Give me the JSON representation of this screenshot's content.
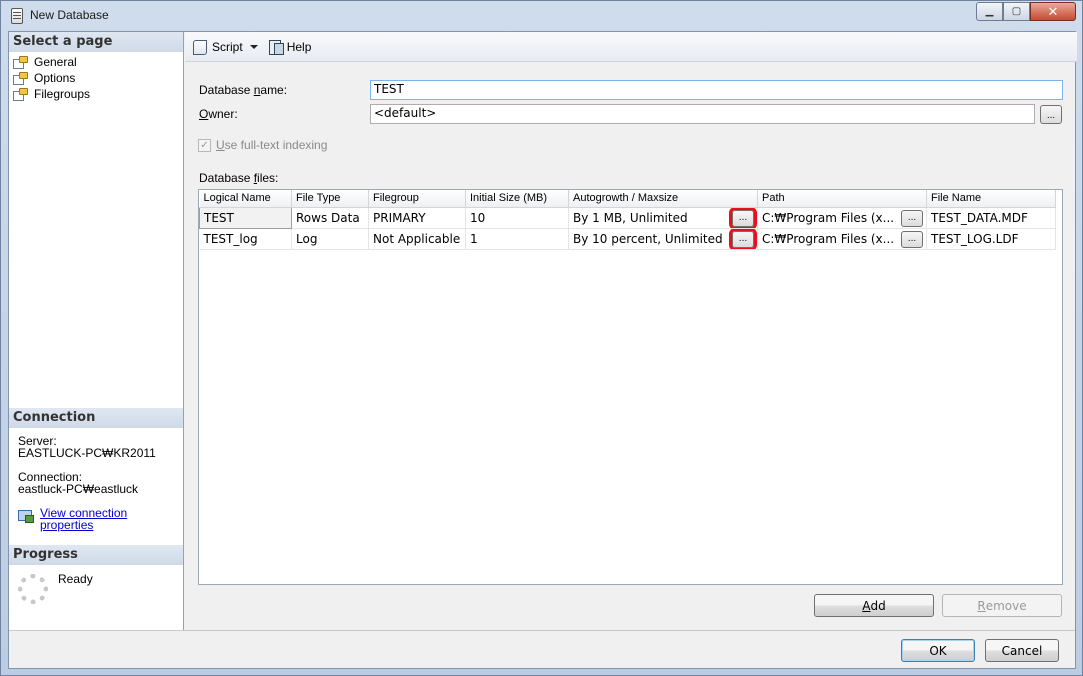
{
  "window": {
    "title": "New Database"
  },
  "left": {
    "select_page_header": "Select a page",
    "pages": [
      "General",
      "Options",
      "Filegroups"
    ],
    "connection_header": "Connection",
    "server_label": "Server:",
    "server_value": "EASTLUCK-PC₩KR2011",
    "connection_label": "Connection:",
    "connection_value": "eastluck-PC₩eastluck",
    "view_link_line1": "View connection",
    "view_link_line2": "properties",
    "progress_header": "Progress",
    "progress_status": "Ready"
  },
  "toolbar": {
    "script_label": "Script",
    "help_label": "Help"
  },
  "form": {
    "db_name_label_pre": "Database ",
    "db_name_label_ul": "n",
    "db_name_label_post": "ame:",
    "db_name_value": "TEST",
    "owner_label_ul": "O",
    "owner_label_post": "wner:",
    "owner_value": "<default>",
    "browse_label": "...",
    "fulltext_label_ul": "U",
    "fulltext_label_post": "se full-text indexing",
    "fulltext_checked": true,
    "db_files_label_pre": "Database ",
    "db_files_label_ul": "f",
    "db_files_label_post": "iles:"
  },
  "grid": {
    "columns": [
      "Logical Name",
      "File Type",
      "Filegroup",
      "Initial Size (MB)",
      "Autogrowth / Maxsize",
      "Path",
      "File Name"
    ],
    "rows": [
      {
        "logical": "TEST",
        "type": "Rows Data",
        "filegroup": "PRIMARY",
        "size": "10",
        "autogrowth": "By 1 MB, Unlimited",
        "path": "C:₩Program Files (x...",
        "file": "TEST_DATA.MDF"
      },
      {
        "logical": "TEST_log",
        "type": "Log",
        "filegroup": "Not Applicable",
        "size": "1",
        "autogrowth": "By 10 percent, Unlimited",
        "path": "C:₩Program Files (x...",
        "file": "TEST_LOG.LDF"
      }
    ],
    "cell_button_label": "..."
  },
  "buttons": {
    "add_ul": "A",
    "add_post": "dd",
    "remove_ul": "R",
    "remove_post": "emove",
    "ok": "OK",
    "cancel": "Cancel"
  },
  "colors": {
    "highlight": "#e8101e",
    "link": "#0000d0",
    "section_header": "#cfdae8"
  }
}
